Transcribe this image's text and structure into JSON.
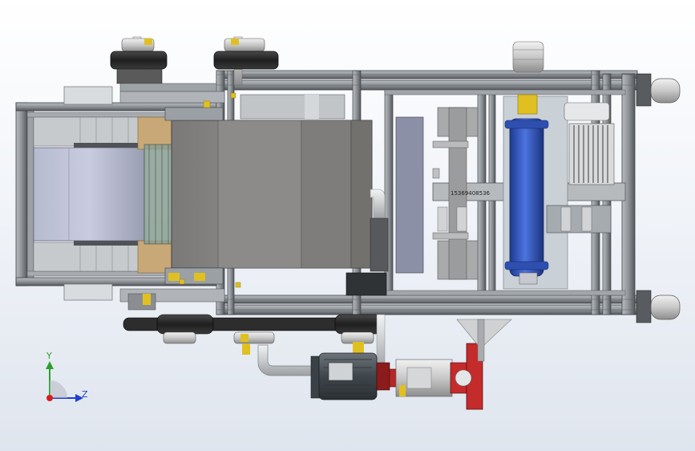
{
  "viewport": {
    "background_top": "#ffffff",
    "background_bottom": "#dfe5ee"
  },
  "model": {
    "part_label": "15369408536",
    "colors": {
      "frame": "#8e9397",
      "frame_dark": "#3e4246",
      "plate": "#8a8886",
      "plate_dark": "#6f6d6b",
      "belt_roll": "#c2c6d8",
      "cylinder": "#3a5fc7",
      "brass": "#e0c020",
      "red_flange": "#c42b2b",
      "motor": "#4a5258",
      "pipe": "#d8dadc",
      "wood": "#c9a877",
      "dark_belt": "#2d2d2d"
    }
  },
  "triad": {
    "y_label": "Y",
    "z_label": "Z",
    "y_color": "#2f9e2f",
    "z_color": "#1e3fd6",
    "origin_color": "#d11f1f"
  }
}
